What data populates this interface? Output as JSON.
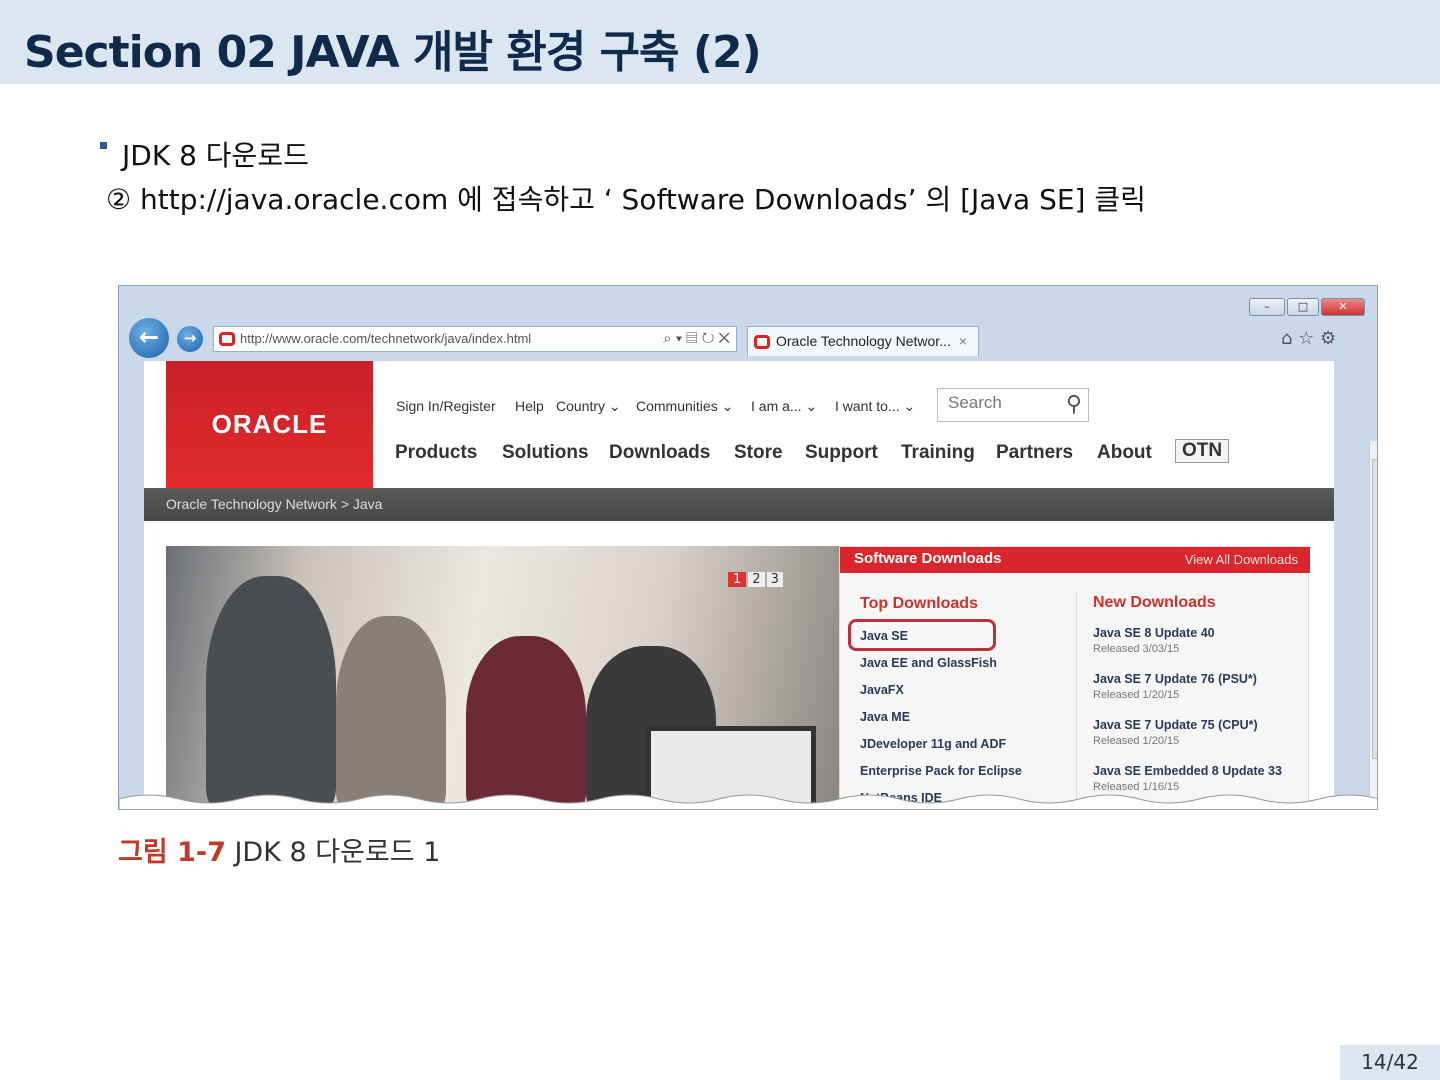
{
  "slide": {
    "title": "Section 02 JAVA  개발 환경 구축 (2)",
    "bullet": "JDK 8  다운로드",
    "step": "② http://java.oracle.com 에 접속하고 ‘ Software Downloads’ 의  [Java SE]  클릭",
    "caption_num": "그림 1-7",
    "caption_text": "JDK 8 다운로드 1",
    "page_number": "14/42"
  },
  "browser": {
    "url": "http://www.oracle.com/technetwork/java/index.html",
    "tab_title": "Oracle Technology Networ...",
    "addr_icons": "⌕ ▾ ▤ ↻ ✕",
    "tab_close": "×"
  },
  "oracle": {
    "logo": "ORACLE",
    "util_links": [
      "Sign In/Register",
      "Help",
      "Country ⌄",
      "Communities ⌄",
      "I am a... ⌄",
      "I want to... ⌄"
    ],
    "search_placeholder": "Search",
    "nav": [
      "Products",
      "Solutions",
      "Downloads",
      "Store",
      "Support",
      "Training",
      "Partners",
      "About",
      "OTN"
    ],
    "breadcrumb": "Oracle Technology Network  >  Java",
    "carousel": [
      "1",
      "2",
      "3"
    ],
    "downloads": {
      "title": "Software Downloads",
      "view_all": "View All Downloads",
      "top_heading": "Top Downloads",
      "top": [
        "Java SE",
        "Java EE and GlassFish",
        "JavaFX",
        "Java ME",
        "JDeveloper 11g and ADF",
        "Enterprise Pack for Eclipse",
        "NetBeans IDE"
      ],
      "new_heading": "New Downloads",
      "new": [
        {
          "name": "Java SE 8 Update 40",
          "released": "Released 3/03/15"
        },
        {
          "name": "Java SE 7 Update 76 (PSU*)",
          "released": "Released 1/20/15"
        },
        {
          "name": "Java SE 7 Update 75 (CPU*)",
          "released": "Released 1/20/15"
        },
        {
          "name": "Java SE Embedded 8 Update 33",
          "released": "Released 1/16/15"
        }
      ]
    }
  }
}
